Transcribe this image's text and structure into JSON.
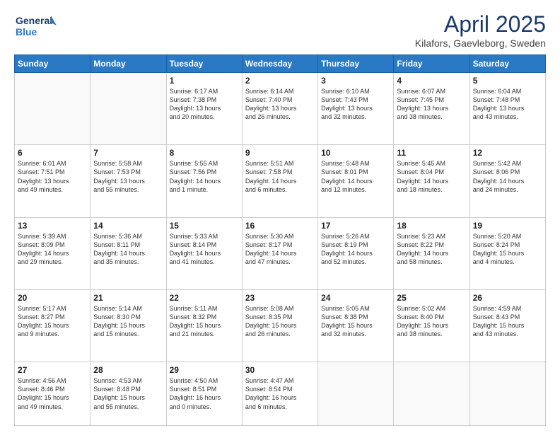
{
  "header": {
    "logo_line1": "General",
    "logo_line2": "Blue",
    "month": "April 2025",
    "location": "Kilafors, Gaevleborg, Sweden"
  },
  "days_of_week": [
    "Sunday",
    "Monday",
    "Tuesday",
    "Wednesday",
    "Thursday",
    "Friday",
    "Saturday"
  ],
  "weeks": [
    [
      {
        "day": "",
        "info": ""
      },
      {
        "day": "",
        "info": ""
      },
      {
        "day": "1",
        "info": "Sunrise: 6:17 AM\nSunset: 7:38 PM\nDaylight: 13 hours\nand 20 minutes."
      },
      {
        "day": "2",
        "info": "Sunrise: 6:14 AM\nSunset: 7:40 PM\nDaylight: 13 hours\nand 26 minutes."
      },
      {
        "day": "3",
        "info": "Sunrise: 6:10 AM\nSunset: 7:43 PM\nDaylight: 13 hours\nand 32 minutes."
      },
      {
        "day": "4",
        "info": "Sunrise: 6:07 AM\nSunset: 7:45 PM\nDaylight: 13 hours\nand 38 minutes."
      },
      {
        "day": "5",
        "info": "Sunrise: 6:04 AM\nSunset: 7:48 PM\nDaylight: 13 hours\nand 43 minutes."
      }
    ],
    [
      {
        "day": "6",
        "info": "Sunrise: 6:01 AM\nSunset: 7:51 PM\nDaylight: 13 hours\nand 49 minutes."
      },
      {
        "day": "7",
        "info": "Sunrise: 5:58 AM\nSunset: 7:53 PM\nDaylight: 13 hours\nand 55 minutes."
      },
      {
        "day": "8",
        "info": "Sunrise: 5:55 AM\nSunset: 7:56 PM\nDaylight: 14 hours\nand 1 minute."
      },
      {
        "day": "9",
        "info": "Sunrise: 5:51 AM\nSunset: 7:58 PM\nDaylight: 14 hours\nand 6 minutes."
      },
      {
        "day": "10",
        "info": "Sunrise: 5:48 AM\nSunset: 8:01 PM\nDaylight: 14 hours\nand 12 minutes."
      },
      {
        "day": "11",
        "info": "Sunrise: 5:45 AM\nSunset: 8:04 PM\nDaylight: 14 hours\nand 18 minutes."
      },
      {
        "day": "12",
        "info": "Sunrise: 5:42 AM\nSunset: 8:06 PM\nDaylight: 14 hours\nand 24 minutes."
      }
    ],
    [
      {
        "day": "13",
        "info": "Sunrise: 5:39 AM\nSunset: 8:09 PM\nDaylight: 14 hours\nand 29 minutes."
      },
      {
        "day": "14",
        "info": "Sunrise: 5:36 AM\nSunset: 8:11 PM\nDaylight: 14 hours\nand 35 minutes."
      },
      {
        "day": "15",
        "info": "Sunrise: 5:33 AM\nSunset: 8:14 PM\nDaylight: 14 hours\nand 41 minutes."
      },
      {
        "day": "16",
        "info": "Sunrise: 5:30 AM\nSunset: 8:17 PM\nDaylight: 14 hours\nand 47 minutes."
      },
      {
        "day": "17",
        "info": "Sunrise: 5:26 AM\nSunset: 8:19 PM\nDaylight: 14 hours\nand 52 minutes."
      },
      {
        "day": "18",
        "info": "Sunrise: 5:23 AM\nSunset: 8:22 PM\nDaylight: 14 hours\nand 58 minutes."
      },
      {
        "day": "19",
        "info": "Sunrise: 5:20 AM\nSunset: 8:24 PM\nDaylight: 15 hours\nand 4 minutes."
      }
    ],
    [
      {
        "day": "20",
        "info": "Sunrise: 5:17 AM\nSunset: 8:27 PM\nDaylight: 15 hours\nand 9 minutes."
      },
      {
        "day": "21",
        "info": "Sunrise: 5:14 AM\nSunset: 8:30 PM\nDaylight: 15 hours\nand 15 minutes."
      },
      {
        "day": "22",
        "info": "Sunrise: 5:11 AM\nSunset: 8:32 PM\nDaylight: 15 hours\nand 21 minutes."
      },
      {
        "day": "23",
        "info": "Sunrise: 5:08 AM\nSunset: 8:35 PM\nDaylight: 15 hours\nand 26 minutes."
      },
      {
        "day": "24",
        "info": "Sunrise: 5:05 AM\nSunset: 8:38 PM\nDaylight: 15 hours\nand 32 minutes."
      },
      {
        "day": "25",
        "info": "Sunrise: 5:02 AM\nSunset: 8:40 PM\nDaylight: 15 hours\nand 38 minutes."
      },
      {
        "day": "26",
        "info": "Sunrise: 4:59 AM\nSunset: 8:43 PM\nDaylight: 15 hours\nand 43 minutes."
      }
    ],
    [
      {
        "day": "27",
        "info": "Sunrise: 4:56 AM\nSunset: 8:46 PM\nDaylight: 15 hours\nand 49 minutes."
      },
      {
        "day": "28",
        "info": "Sunrise: 4:53 AM\nSunset: 8:48 PM\nDaylight: 15 hours\nand 55 minutes."
      },
      {
        "day": "29",
        "info": "Sunrise: 4:50 AM\nSunset: 8:51 PM\nDaylight: 16 hours\nand 0 minutes."
      },
      {
        "day": "30",
        "info": "Sunrise: 4:47 AM\nSunset: 8:54 PM\nDaylight: 16 hours\nand 6 minutes."
      },
      {
        "day": "",
        "info": ""
      },
      {
        "day": "",
        "info": ""
      },
      {
        "day": "",
        "info": ""
      }
    ]
  ]
}
